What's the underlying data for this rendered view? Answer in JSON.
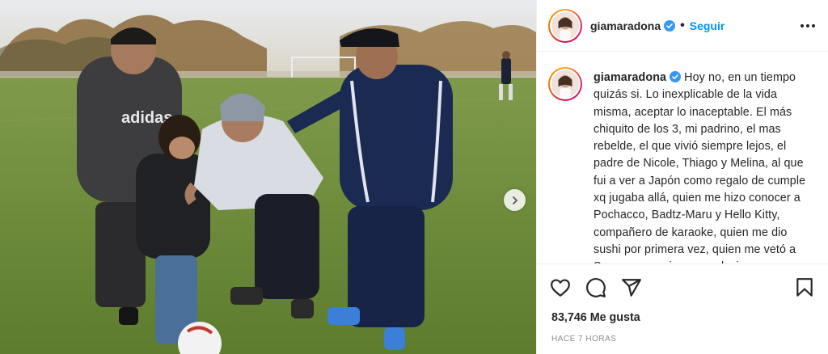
{
  "post": {
    "username": "giamaradona",
    "follow_label": "Seguir",
    "separator": "•",
    "caption": "Hoy no, en un tiempo quizás si. Lo inexplicable de la vida misma, aceptar lo inaceptable. El más chiquito de los 3, mi padrino, el mas rebelde, el que vivió siempre lejos, el padre de Nicole, Thiago y Melina, al que fui a ver a Japón como regalo de cumple xq jugaba allá, quien me hizo conocer a Pochacco, Badtz-Maru y Hello Kitty, compañero de karaoke, quien me dio sushi por primera vez, quien me vetó a Snoopy para siempre x decirme que era",
    "likes": "83,746 Me gusta",
    "time": "HACE 7 HORAS"
  },
  "icons": {
    "verified": "verified-badge-icon",
    "more": "more-options-icon",
    "like": "heart-icon",
    "comment": "comment-icon",
    "share": "send-icon",
    "save": "bookmark-icon",
    "next": "chevron-right-icon"
  },
  "colors": {
    "accent": "#0095f6",
    "text": "#262626",
    "muted": "#8e8e8e",
    "border": "#efefef"
  }
}
